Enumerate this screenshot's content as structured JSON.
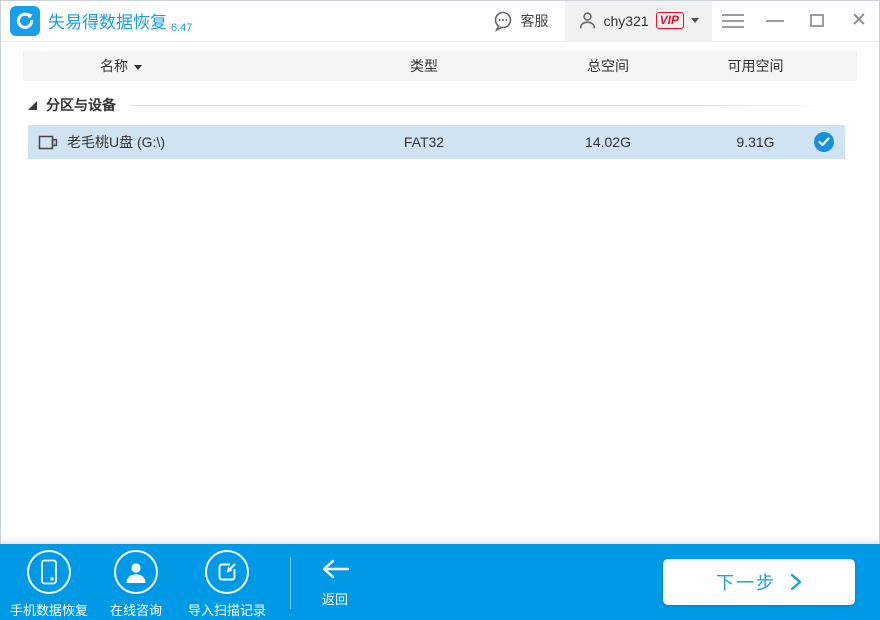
{
  "titlebar": {
    "app_name": "失易得数据恢复",
    "version": "6.47",
    "support_label": "客服",
    "username": "chy321",
    "vip_label": "VIP"
  },
  "table": {
    "headers": {
      "name": "名称",
      "type": "类型",
      "total": "总空间",
      "free": "可用空间"
    },
    "section_title": "分区与设备",
    "rows": [
      {
        "name": "老毛桃U盘 (G:\\)",
        "type": "FAT32",
        "total": "14.02G",
        "free": "9.31G",
        "checked": true
      }
    ]
  },
  "footer": {
    "actions": [
      {
        "label": "手机数据恢复",
        "icon": "phone-icon"
      },
      {
        "label": "在线咨询",
        "icon": "person-icon"
      },
      {
        "label": "导入扫描记录",
        "icon": "import-icon"
      }
    ],
    "back_label": "返回",
    "next_label": "下一步"
  },
  "colors": {
    "accent_blue": "#1a9ee8",
    "footer_blue": "#0099e6",
    "selected_row_blue": "#cfe3f2",
    "check_circle_blue": "#1690d6",
    "vip_red": "#e8112d",
    "header_bar_gray": "#f5f5f5"
  }
}
